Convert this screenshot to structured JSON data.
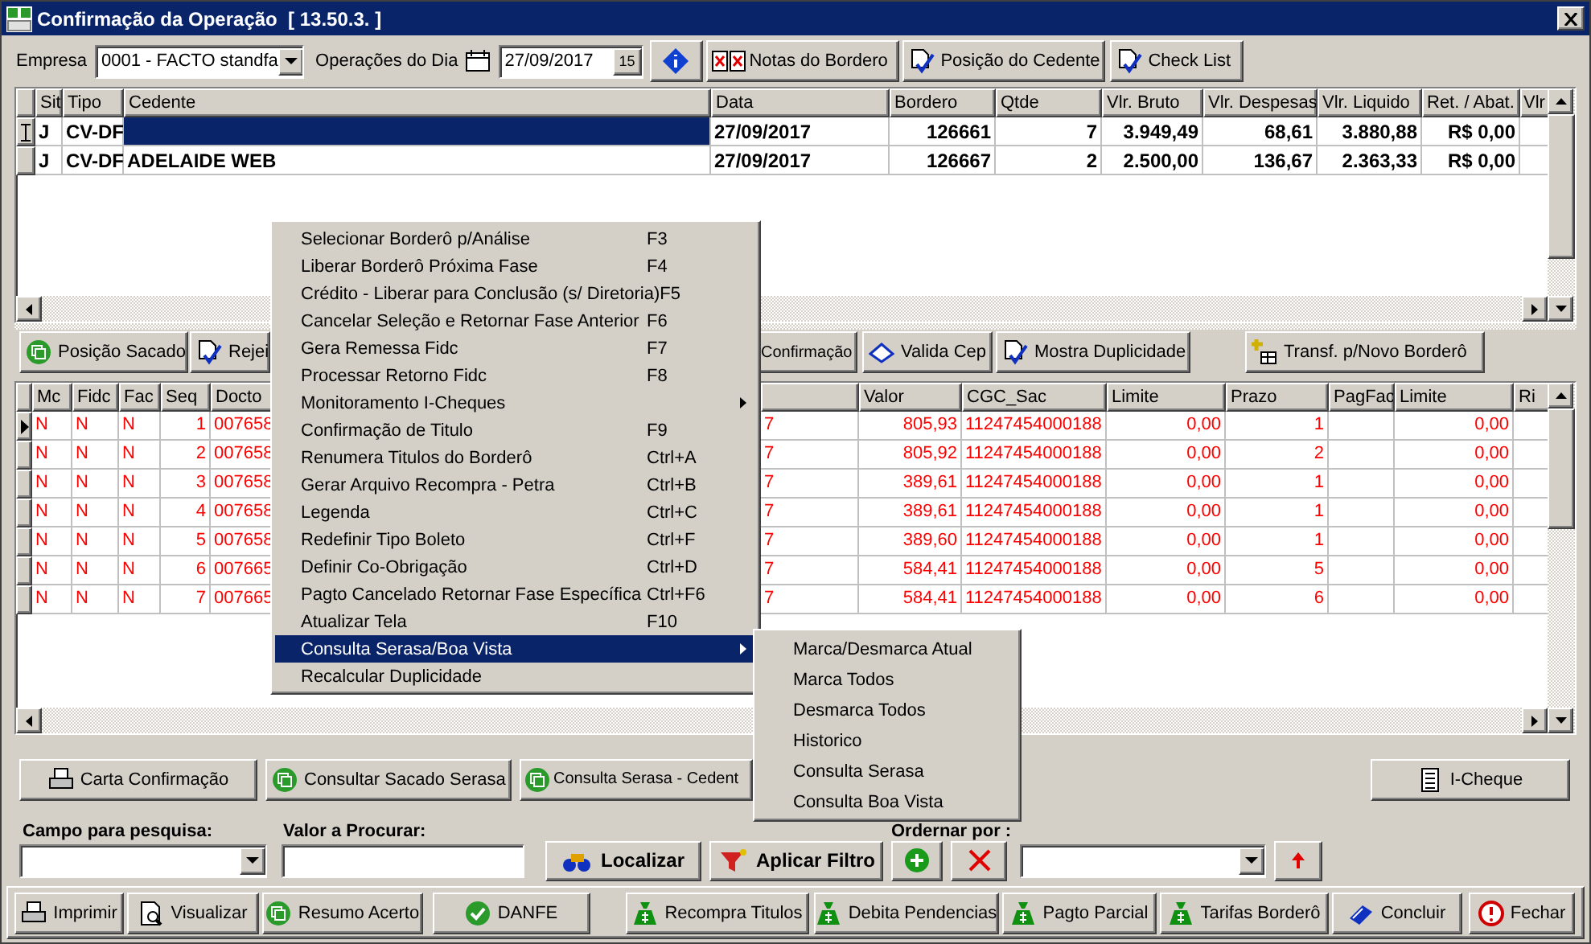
{
  "window": {
    "title": "Confirmação da Operação  [ 13.50.3. ]"
  },
  "toolbar": {
    "empresa_label": "Empresa",
    "empresa_value": "0001 - FACTO standfa",
    "operacoes_label": "Operações do Dia",
    "date_value": "27/09/2017",
    "calendar_day": "15",
    "buttons": [
      "Notas do Bordero",
      "Posição do Cedente",
      "Check List"
    ]
  },
  "top_grid": {
    "columns": [
      "Sit",
      "Tipo",
      "Cedente",
      "Data",
      "Bordero",
      "Qtde",
      "Vlr. Bruto",
      "Vlr. Despesas",
      "Vlr. Liquido",
      "Ret. / Abat.",
      "Vlr"
    ],
    "rows": [
      {
        "editing": true,
        "selected": true,
        "sit": "J",
        "tipo": "CV-DF",
        "data": "27/09/2017",
        "bordero": "126661",
        "qtde": "7",
        "vlr_bruto": "3.949,49",
        "vlr_despesas": "68,61",
        "vlr_liquido": "3.880,88",
        "ret_abat": "R$ 0,00"
      },
      {
        "editing": false,
        "selected": false,
        "sit": "J",
        "tipo": "CV-DF",
        "cedente": "ADELAIDE WEB",
        "data": "27/09/2017",
        "bordero": "126667",
        "qtde": "2",
        "vlr_bruto": "2.500,00",
        "vlr_despesas": "136,67",
        "vlr_liquido": "2.363,33",
        "ret_abat": "R$ 0,00"
      }
    ]
  },
  "action_buttons": [
    "Posição Sacado",
    "Rejei",
    "Confirmação",
    "Valida Cep",
    "Mostra Duplicidade",
    "Transf. p/Novo Borderô"
  ],
  "lower_grid": {
    "columns": [
      "Mc",
      "Fidc",
      "Fac",
      "Seq",
      "Docto",
      "Valor",
      "CGC_Sac",
      "Limite",
      "Prazo",
      "PagFac",
      "Limite",
      "Ri"
    ],
    "rows": [
      {
        "current": true,
        "mc": "N",
        "fidc": "N",
        "fac": "N",
        "seq": "1",
        "docto": "007658",
        "column_6": "7",
        "valor": "805,93",
        "cgc_sac": "11247454000188",
        "limite": "0,00",
        "prazo": "1",
        "limite_2": "0,00"
      },
      {
        "current": false,
        "mc": "N",
        "fidc": "N",
        "fac": "N",
        "seq": "2",
        "docto": "007658",
        "column_6": "7",
        "valor": "805,92",
        "cgc_sac": "11247454000188",
        "limite": "0,00",
        "prazo": "2",
        "limite_2": "0,00"
      },
      {
        "current": false,
        "mc": "N",
        "fidc": "N",
        "fac": "N",
        "seq": "3",
        "docto": "007658",
        "column_6": "7",
        "valor": "389,61",
        "cgc_sac": "11247454000188",
        "limite": "0,00",
        "prazo": "1",
        "limite_2": "0,00"
      },
      {
        "current": false,
        "mc": "N",
        "fidc": "N",
        "fac": "N",
        "seq": "4",
        "docto": "007658",
        "column_6": "7",
        "valor": "389,61",
        "cgc_sac": "11247454000188",
        "limite": "0,00",
        "prazo": "1",
        "limite_2": "0,00"
      },
      {
        "current": false,
        "mc": "N",
        "fidc": "N",
        "fac": "N",
        "seq": "5",
        "docto": "007658",
        "column_6": "7",
        "valor": "389,60",
        "cgc_sac": "11247454000188",
        "limite": "0,00",
        "prazo": "1",
        "limite_2": "0,00"
      },
      {
        "current": false,
        "mc": "N",
        "fidc": "N",
        "fac": "N",
        "seq": "6",
        "docto": "007665",
        "column_6": "7",
        "valor": "584,41",
        "cgc_sac": "11247454000188",
        "limite": "0,00",
        "prazo": "5",
        "limite_2": "0,00"
      },
      {
        "current": false,
        "mc": "N",
        "fidc": "N",
        "fac": "N",
        "seq": "7",
        "docto": "007665",
        "column_6": "7",
        "valor": "584,41",
        "cgc_sac": "11247454000188",
        "limite": "0,00",
        "prazo": "6",
        "limite_2": "0,00"
      }
    ]
  },
  "lower_buttons": [
    "Carta Confirmação",
    "Consultar Sacado Serasa",
    "Consulta Serasa - Cedent",
    "I-Cheque"
  ],
  "search": {
    "campo_label": "Campo para pesquisa:",
    "valor_label": "Valor a Procurar:",
    "ordenar_label": "Ordernar por :",
    "localizar": "Localizar",
    "filtro": "Aplicar Filtro"
  },
  "bottom_toolbar": [
    "Imprimir",
    "Visualizar",
    "Resumo Acerto",
    "DANFE",
    "Recompra Titulos",
    "Debita Pendencias",
    "Pagto Parcial",
    "Tarifas Borderô",
    "Concluir",
    "Fechar"
  ],
  "context_menu": [
    {
      "label": "Selecionar Borderô p/Análise",
      "shortcut": "F3",
      "has_submenu": false,
      "selected": false
    },
    {
      "label": "Liberar Borderô Próxima Fase",
      "shortcut": "F4",
      "has_submenu": false,
      "selected": false
    },
    {
      "label": "Crédito - Liberar para Conclusão (s/ Diretoria)",
      "shortcut": "F5",
      "has_submenu": false,
      "selected": false
    },
    {
      "label": "Cancelar Seleção e Retornar Fase Anterior",
      "shortcut": "F6",
      "has_submenu": false,
      "selected": false
    },
    {
      "label": "Gera Remessa Fidc",
      "shortcut": "F7",
      "has_submenu": false,
      "selected": false
    },
    {
      "label": "Processar Retorno Fidc",
      "shortcut": "F8",
      "has_submenu": false,
      "selected": false
    },
    {
      "label": "Monitoramento  I-Cheques",
      "has_submenu": true,
      "selected": false
    },
    {
      "label": "Confirmação de Titulo",
      "shortcut": "F9",
      "has_submenu": false,
      "selected": false
    },
    {
      "label": "Renumera Titulos do Borderô",
      "shortcut": "Ctrl+A",
      "has_submenu": false,
      "selected": false
    },
    {
      "label": "Gerar Arquivo Recompra - Petra",
      "shortcut": "Ctrl+B",
      "has_submenu": false,
      "selected": false
    },
    {
      "label": "Legenda",
      "shortcut": "Ctrl+C",
      "has_submenu": false,
      "selected": false
    },
    {
      "label": "Redefinir Tipo Boleto",
      "shortcut": "Ctrl+F",
      "has_submenu": false,
      "selected": false
    },
    {
      "label": "Definir Co-Obrigação",
      "shortcut": "Ctrl+D",
      "has_submenu": false,
      "selected": false
    },
    {
      "label": "Pagto Cancelado Retornar Fase Específica",
      "shortcut": "Ctrl+F6",
      "has_submenu": false,
      "selected": false
    },
    {
      "label": "Atualizar Tela",
      "shortcut": "F10",
      "has_submenu": false,
      "selected": false
    },
    {
      "label": "Consulta Serasa/Boa Vista",
      "has_submenu": true,
      "selected": true
    },
    {
      "label": "Recalcular Duplicidade",
      "has_submenu": false,
      "selected": false
    }
  ],
  "submenu": [
    {
      "label": "Marca/Desmarca  Atual",
      "selected": false
    },
    {
      "label": "Marca Todos",
      "selected": false
    },
    {
      "label": "Desmarca Todos",
      "selected": false
    },
    {
      "label": "Historico",
      "selected": false
    },
    {
      "label": "Consulta Serasa",
      "selected": false
    },
    {
      "label": "Consulta Boa Vista",
      "selected": false
    }
  ]
}
